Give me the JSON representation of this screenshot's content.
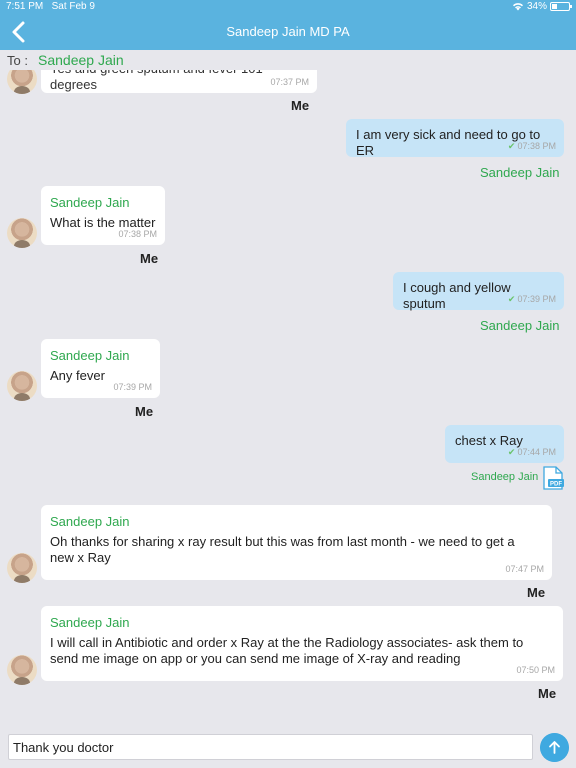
{
  "status": {
    "time": "7:51 PM",
    "date": "Sat Feb 9",
    "battery": "34%",
    "battery_level": 0.34
  },
  "nav": {
    "title": "Sandeep Jain MD PA"
  },
  "to": {
    "label": "To :",
    "name": "Sandeep Jain"
  },
  "messages": [
    {
      "text": "Yes and green sputum and fever 101 degrees",
      "time": "07:37 PM",
      "label": "Me"
    },
    {
      "text": "I am very sick and need to go to ER",
      "time": "07:38 PM",
      "label": "Sandeep Jain"
    },
    {
      "sender": "Sandeep Jain",
      "text": "What is the matter",
      "time": "07:38 PM",
      "label": "Me"
    },
    {
      "text": "I cough and yellow sputum",
      "time": "07:39 PM",
      "label": "Sandeep Jain"
    },
    {
      "sender": "Sandeep Jain",
      "text": "Any fever",
      "time": "07:39 PM",
      "label": "Me"
    },
    {
      "text": "chest x Ray",
      "time": "07:44 PM",
      "label": "Sandeep Jain",
      "attachment": "PDF"
    },
    {
      "sender": "Sandeep Jain",
      "text": "Oh thanks for sharing x ray result but this was from last month - we need to get a new x Ray",
      "time": "07:47 PM",
      "label": "Me"
    },
    {
      "sender": "Sandeep Jain",
      "text": "I will call in Antibiotic and order x Ray at the the Radiology associates- ask them to send me image on app or you can send me image of X-ray  and reading",
      "time": "07:50 PM",
      "label": "Me"
    }
  ],
  "composer": {
    "value": "Thank you doctor"
  },
  "icons": {
    "back": "chevron-left-icon",
    "wifi": "wifi-icon",
    "battery": "battery-icon",
    "pdf": "pdf-file-icon",
    "send": "arrow-up-icon"
  },
  "colors": {
    "header": "#5ab3df",
    "sender_green": "#2fa84f",
    "outgoing_bubble": "#c6e4f7",
    "incoming_bubble": "#ffffff",
    "send_button": "#3fa9e0",
    "background": "#e7e7ec"
  }
}
